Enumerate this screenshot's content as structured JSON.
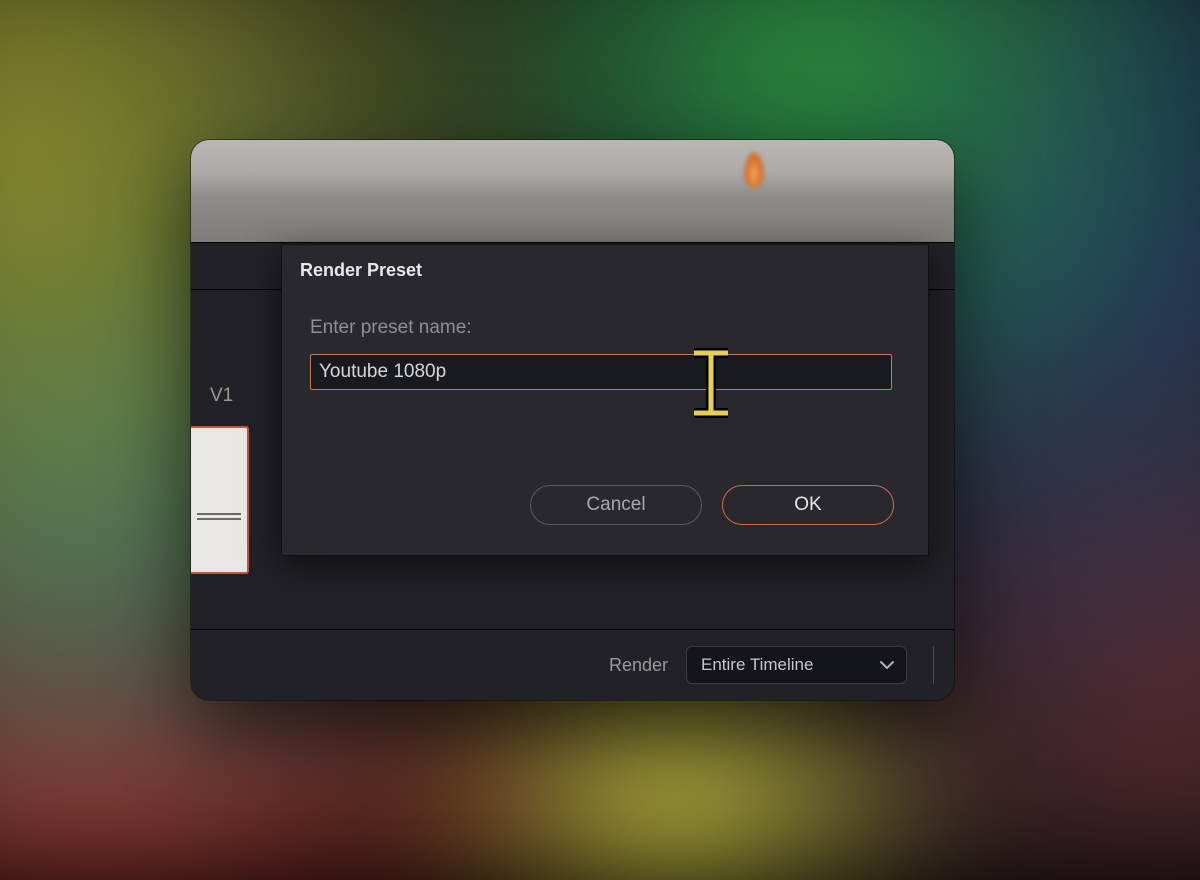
{
  "dialog": {
    "title": "Render Preset",
    "prompt": "Enter preset name:",
    "input_value": "Youtube 1080p",
    "cancel_label": "Cancel",
    "ok_label": "OK"
  },
  "track_label": "V1",
  "bottom": {
    "render_label": "Render",
    "dropdown_value": "Entire Timeline"
  },
  "colors": {
    "accent": "#cc6b4a",
    "panel": "#28282e",
    "window": "#212127"
  }
}
